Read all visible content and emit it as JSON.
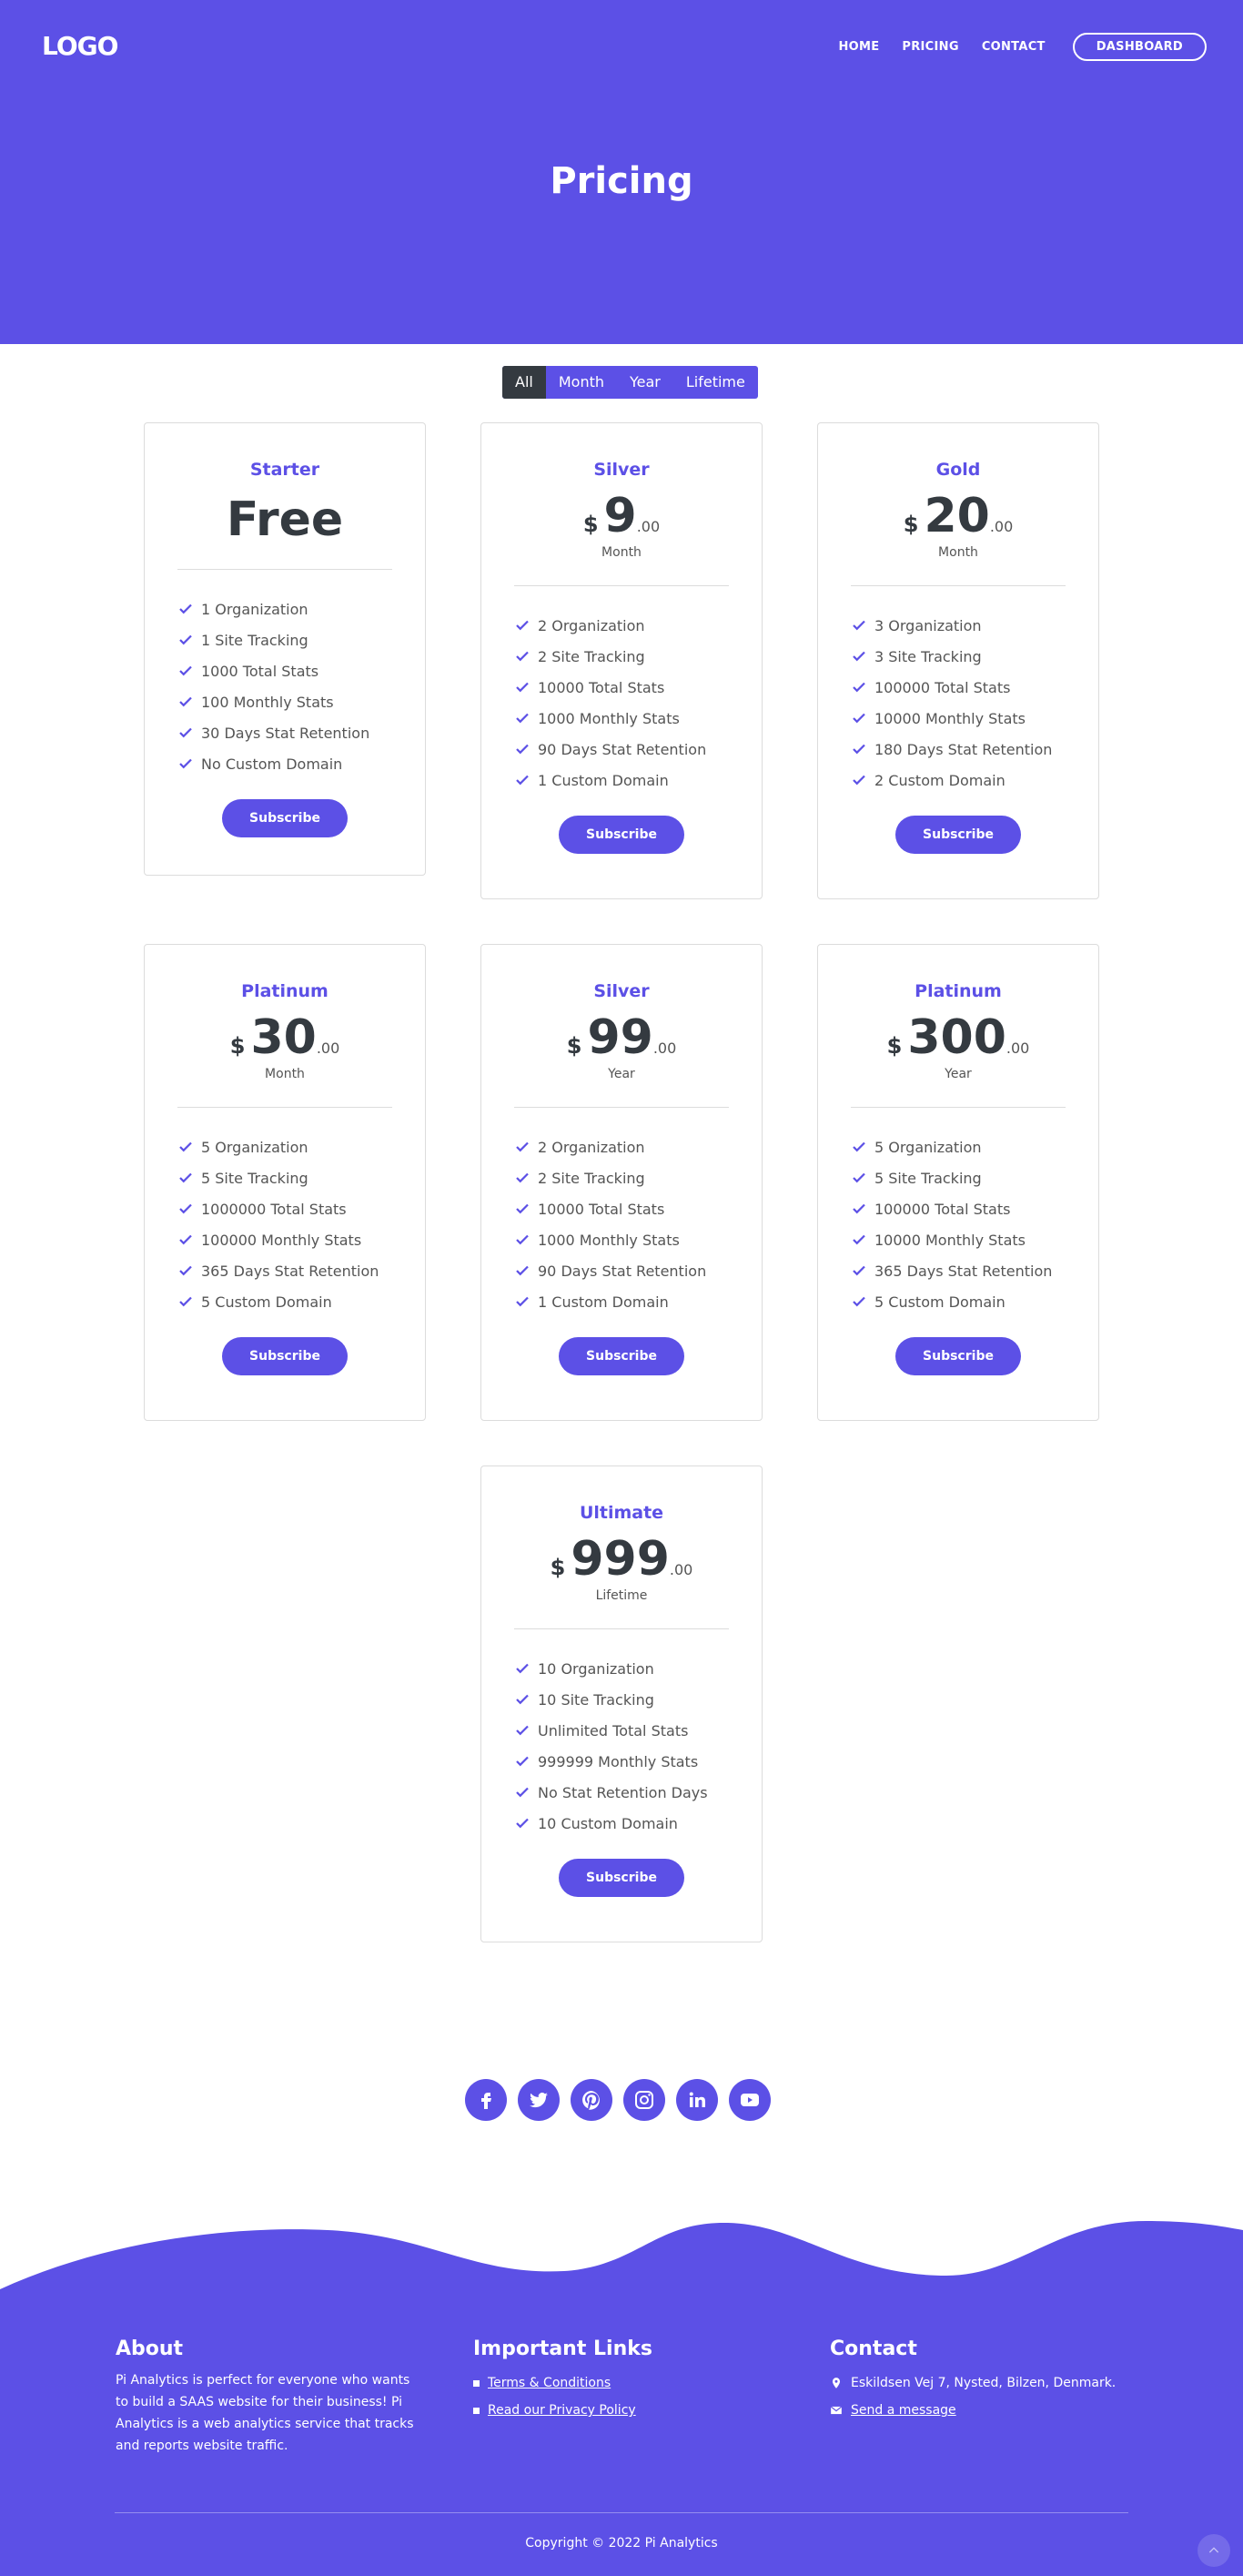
{
  "header": {
    "logo": "LOGO",
    "nav": [
      "HOME",
      "PRICING",
      "CONTACT"
    ],
    "dashboard": "DASHBOARD",
    "title": "Pricing"
  },
  "filter": {
    "tabs": [
      "All",
      "Month",
      "Year",
      "Lifetime"
    ],
    "active": "All"
  },
  "cards": [
    {
      "name": "Starter",
      "free": "Free",
      "features": [
        "1 Organization",
        "1 Site Tracking",
        "1000 Total Stats",
        "100 Monthly Stats",
        "30 Days Stat Retention",
        "No Custom Domain"
      ],
      "button": "Subscribe"
    },
    {
      "name": "Silver",
      "currency": "$",
      "amount": "9",
      "cents": ".00",
      "period": "Month",
      "features": [
        "2 Organization",
        "2 Site Tracking",
        "10000 Total Stats",
        "1000 Monthly Stats",
        "90 Days Stat Retention",
        "1 Custom Domain"
      ],
      "button": "Subscribe"
    },
    {
      "name": "Gold",
      "currency": "$",
      "amount": "20",
      "cents": ".00",
      "period": "Month",
      "features": [
        "3 Organization",
        "3 Site Tracking",
        "100000 Total Stats",
        "10000 Monthly Stats",
        "180 Days Stat Retention",
        "2 Custom Domain"
      ],
      "button": "Subscribe"
    },
    {
      "name": "Platinum",
      "currency": "$",
      "amount": "30",
      "cents": ".00",
      "period": "Month",
      "features": [
        "5 Organization",
        "5 Site Tracking",
        "1000000 Total Stats",
        "100000 Monthly Stats",
        "365 Days Stat Retention",
        "5 Custom Domain"
      ],
      "button": "Subscribe"
    },
    {
      "name": "Silver",
      "currency": "$",
      "amount": "99",
      "cents": ".00",
      "period": "Year",
      "features": [
        "2 Organization",
        "2 Site Tracking",
        "10000 Total Stats",
        "1000 Monthly Stats",
        "90 Days Stat Retention",
        "1 Custom Domain"
      ],
      "button": "Subscribe"
    },
    {
      "name": "Platinum",
      "currency": "$",
      "amount": "300",
      "cents": ".00",
      "period": "Year",
      "features": [
        "5 Organization",
        "5 Site Tracking",
        "100000 Total Stats",
        "10000 Monthly Stats",
        "365 Days Stat Retention",
        "5 Custom Domain"
      ],
      "button": "Subscribe"
    },
    {
      "name": "Ultimate",
      "currency": "$",
      "amount": "999",
      "cents": ".00",
      "period": "Lifetime",
      "features": [
        "10 Organization",
        "10 Site Tracking",
        "Unlimited Total Stats",
        "999999 Monthly Stats",
        "No Stat Retention Days",
        "10 Custom Domain"
      ],
      "button": "Subscribe"
    }
  ],
  "social": [
    "facebook-icon",
    "twitter-icon",
    "pinterest-icon",
    "instagram-icon",
    "linkedin-icon",
    "youtube-icon"
  ],
  "footer": {
    "about_title": "About",
    "about_text": "Pi Analytics is perfect for everyone who wants to build a SAAS website for their business! Pi Analytics is a web analytics service that tracks and reports website traffic.",
    "links_title": "Important Links",
    "links": [
      "Terms & Conditions",
      "Read our Privacy Policy"
    ],
    "contact_title": "Contact",
    "address": "Eskildsen Vej 7, Nysted, Bilzen, Denmark.",
    "message": "Send a message",
    "copyright": "Copyright © 2022 Pi Analytics"
  },
  "colors": {
    "primary": "#5c50e6",
    "dark": "#343a40"
  }
}
